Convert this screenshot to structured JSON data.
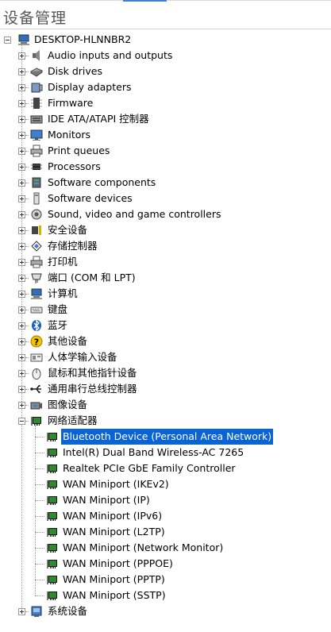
{
  "window": {
    "title": "设备管理"
  },
  "root": {
    "label": "DESKTOP-HLNNBR2",
    "icon": "computer-icon"
  },
  "categories": [
    {
      "label": "Audio inputs and outputs",
      "icon": "speaker-icon",
      "expanded": false
    },
    {
      "label": "Disk drives",
      "icon": "disk-drive-icon",
      "expanded": false
    },
    {
      "label": "Display adapters",
      "icon": "display-adapter-icon",
      "expanded": false
    },
    {
      "label": "Firmware",
      "icon": "firmware-icon",
      "expanded": false
    },
    {
      "label": "IDE ATA/ATAPI 控制器",
      "icon": "ide-controller-icon",
      "expanded": false
    },
    {
      "label": "Monitors",
      "icon": "monitor-icon",
      "expanded": false
    },
    {
      "label": "Print queues",
      "icon": "printer-icon",
      "expanded": false
    },
    {
      "label": "Processors",
      "icon": "processor-icon",
      "expanded": false
    },
    {
      "label": "Software components",
      "icon": "software-component-icon",
      "expanded": false
    },
    {
      "label": "Software devices",
      "icon": "software-device-icon",
      "expanded": false
    },
    {
      "label": "Sound, video and game controllers",
      "icon": "sound-controller-icon",
      "expanded": false
    },
    {
      "label": "安全设备",
      "icon": "security-device-icon",
      "expanded": false
    },
    {
      "label": "存储控制器",
      "icon": "storage-controller-icon",
      "expanded": false
    },
    {
      "label": "打印机",
      "icon": "printer-icon",
      "expanded": false
    },
    {
      "label": "端口 (COM 和 LPT)",
      "icon": "port-icon",
      "expanded": false
    },
    {
      "label": "计算机",
      "icon": "computer-icon",
      "expanded": false
    },
    {
      "label": "键盘",
      "icon": "keyboard-icon",
      "expanded": false
    },
    {
      "label": "蓝牙",
      "icon": "bluetooth-icon",
      "expanded": false
    },
    {
      "label": "其他设备",
      "icon": "unknown-device-icon",
      "expanded": false
    },
    {
      "label": "人体学输入设备",
      "icon": "hid-icon",
      "expanded": false
    },
    {
      "label": "鼠标和其他指针设备",
      "icon": "mouse-icon",
      "expanded": false
    },
    {
      "label": "通用串行总线控制器",
      "icon": "usb-icon",
      "expanded": false
    },
    {
      "label": "图像设备",
      "icon": "camera-icon",
      "expanded": false
    },
    {
      "label": "网络适配器",
      "icon": "network-adapter-icon",
      "expanded": true,
      "children": [
        {
          "label": "Bluetooth Device (Personal Area Network)",
          "icon": "network-adapter-icon",
          "selected": true
        },
        {
          "label": "Intel(R) Dual Band Wireless-AC 7265",
          "icon": "network-adapter-icon"
        },
        {
          "label": "Realtek PCIe GbE Family Controller",
          "icon": "network-adapter-icon"
        },
        {
          "label": "WAN Miniport (IKEv2)",
          "icon": "network-adapter-icon"
        },
        {
          "label": "WAN Miniport (IP)",
          "icon": "network-adapter-icon"
        },
        {
          "label": "WAN Miniport (IPv6)",
          "icon": "network-adapter-icon"
        },
        {
          "label": "WAN Miniport (L2TP)",
          "icon": "network-adapter-icon"
        },
        {
          "label": "WAN Miniport (Network Monitor)",
          "icon": "network-adapter-icon"
        },
        {
          "label": "WAN Miniport (PPPOE)",
          "icon": "network-adapter-icon"
        },
        {
          "label": "WAN Miniport (PPTP)",
          "icon": "network-adapter-icon"
        },
        {
          "label": "WAN Miniport (SSTP)",
          "icon": "network-adapter-icon"
        }
      ]
    },
    {
      "label": "系统设备",
      "icon": "system-device-icon",
      "expanded": false
    }
  ],
  "colors": {
    "selection": "#0a64d2",
    "selection_text": "#ffffff",
    "accent": "#3c7fd8"
  }
}
